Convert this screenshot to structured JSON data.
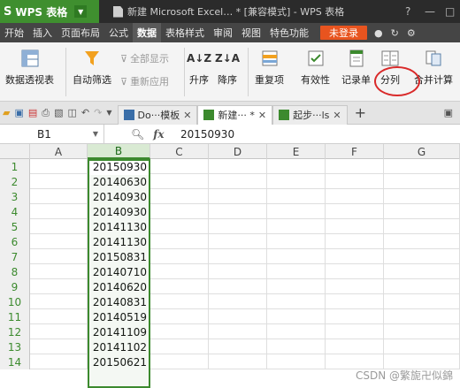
{
  "titlebar": {
    "logo": "S",
    "app_name": "WPS 表格",
    "doc_title": "新建 Microsoft Excel… * [兼容模式] - WPS 表格",
    "controls": [
      "?",
      "—",
      "□"
    ]
  },
  "menubar": {
    "items": [
      "开始",
      "插入",
      "页面布局",
      "公式",
      "数据",
      "表格样式",
      "审阅",
      "视图",
      "特色功能"
    ],
    "active": "数据",
    "login_label": "未登录"
  },
  "ribbon": {
    "pivot_label": "数据透视表",
    "autofilter_label": "自动筛选",
    "show_all_label": "全部显示",
    "reapply_label": "重新应用",
    "sort_asc_label": "升序",
    "sort_desc_label": "降序",
    "duplicates_label": "重复项",
    "validation_label": "有效性",
    "record_label": "记录单",
    "split_label": "分列",
    "consolidate_label": "合并计算",
    "sort_asc_glyph": "A↓Z",
    "sort_desc_glyph": "Z↓A"
  },
  "tabs": [
    {
      "label": "Do···模板",
      "active": false
    },
    {
      "label": "新建··· *",
      "active": true
    },
    {
      "label": "起步···ls",
      "active": false
    }
  ],
  "formula_bar": {
    "cell_ref": "B1",
    "fx_label": "fx",
    "value": "20150930"
  },
  "sheet": {
    "columns": [
      "A",
      "B",
      "C",
      "D",
      "E",
      "F",
      "G"
    ],
    "rows": [
      {
        "n": "1",
        "b": "20150930"
      },
      {
        "n": "2",
        "b": "20140630"
      },
      {
        "n": "3",
        "b": "20140930"
      },
      {
        "n": "4",
        "b": "20140930"
      },
      {
        "n": "5",
        "b": "20141130"
      },
      {
        "n": "6",
        "b": "20141130"
      },
      {
        "n": "7",
        "b": "20150831"
      },
      {
        "n": "8",
        "b": "20140710"
      },
      {
        "n": "9",
        "b": "20140620"
      },
      {
        "n": "10",
        "b": "20140831"
      },
      {
        "n": "11",
        "b": "20140519"
      },
      {
        "n": "12",
        "b": "20141109"
      },
      {
        "n": "13",
        "b": "20141102"
      },
      {
        "n": "14",
        "b": "20150621"
      }
    ],
    "selected_column": "B"
  },
  "watermark": "CSDN @繁旎卍似錦",
  "colors": {
    "accent_green": "#3c8a2e",
    "login_orange": "#e8541f",
    "annotation_red": "#d92a2a"
  }
}
